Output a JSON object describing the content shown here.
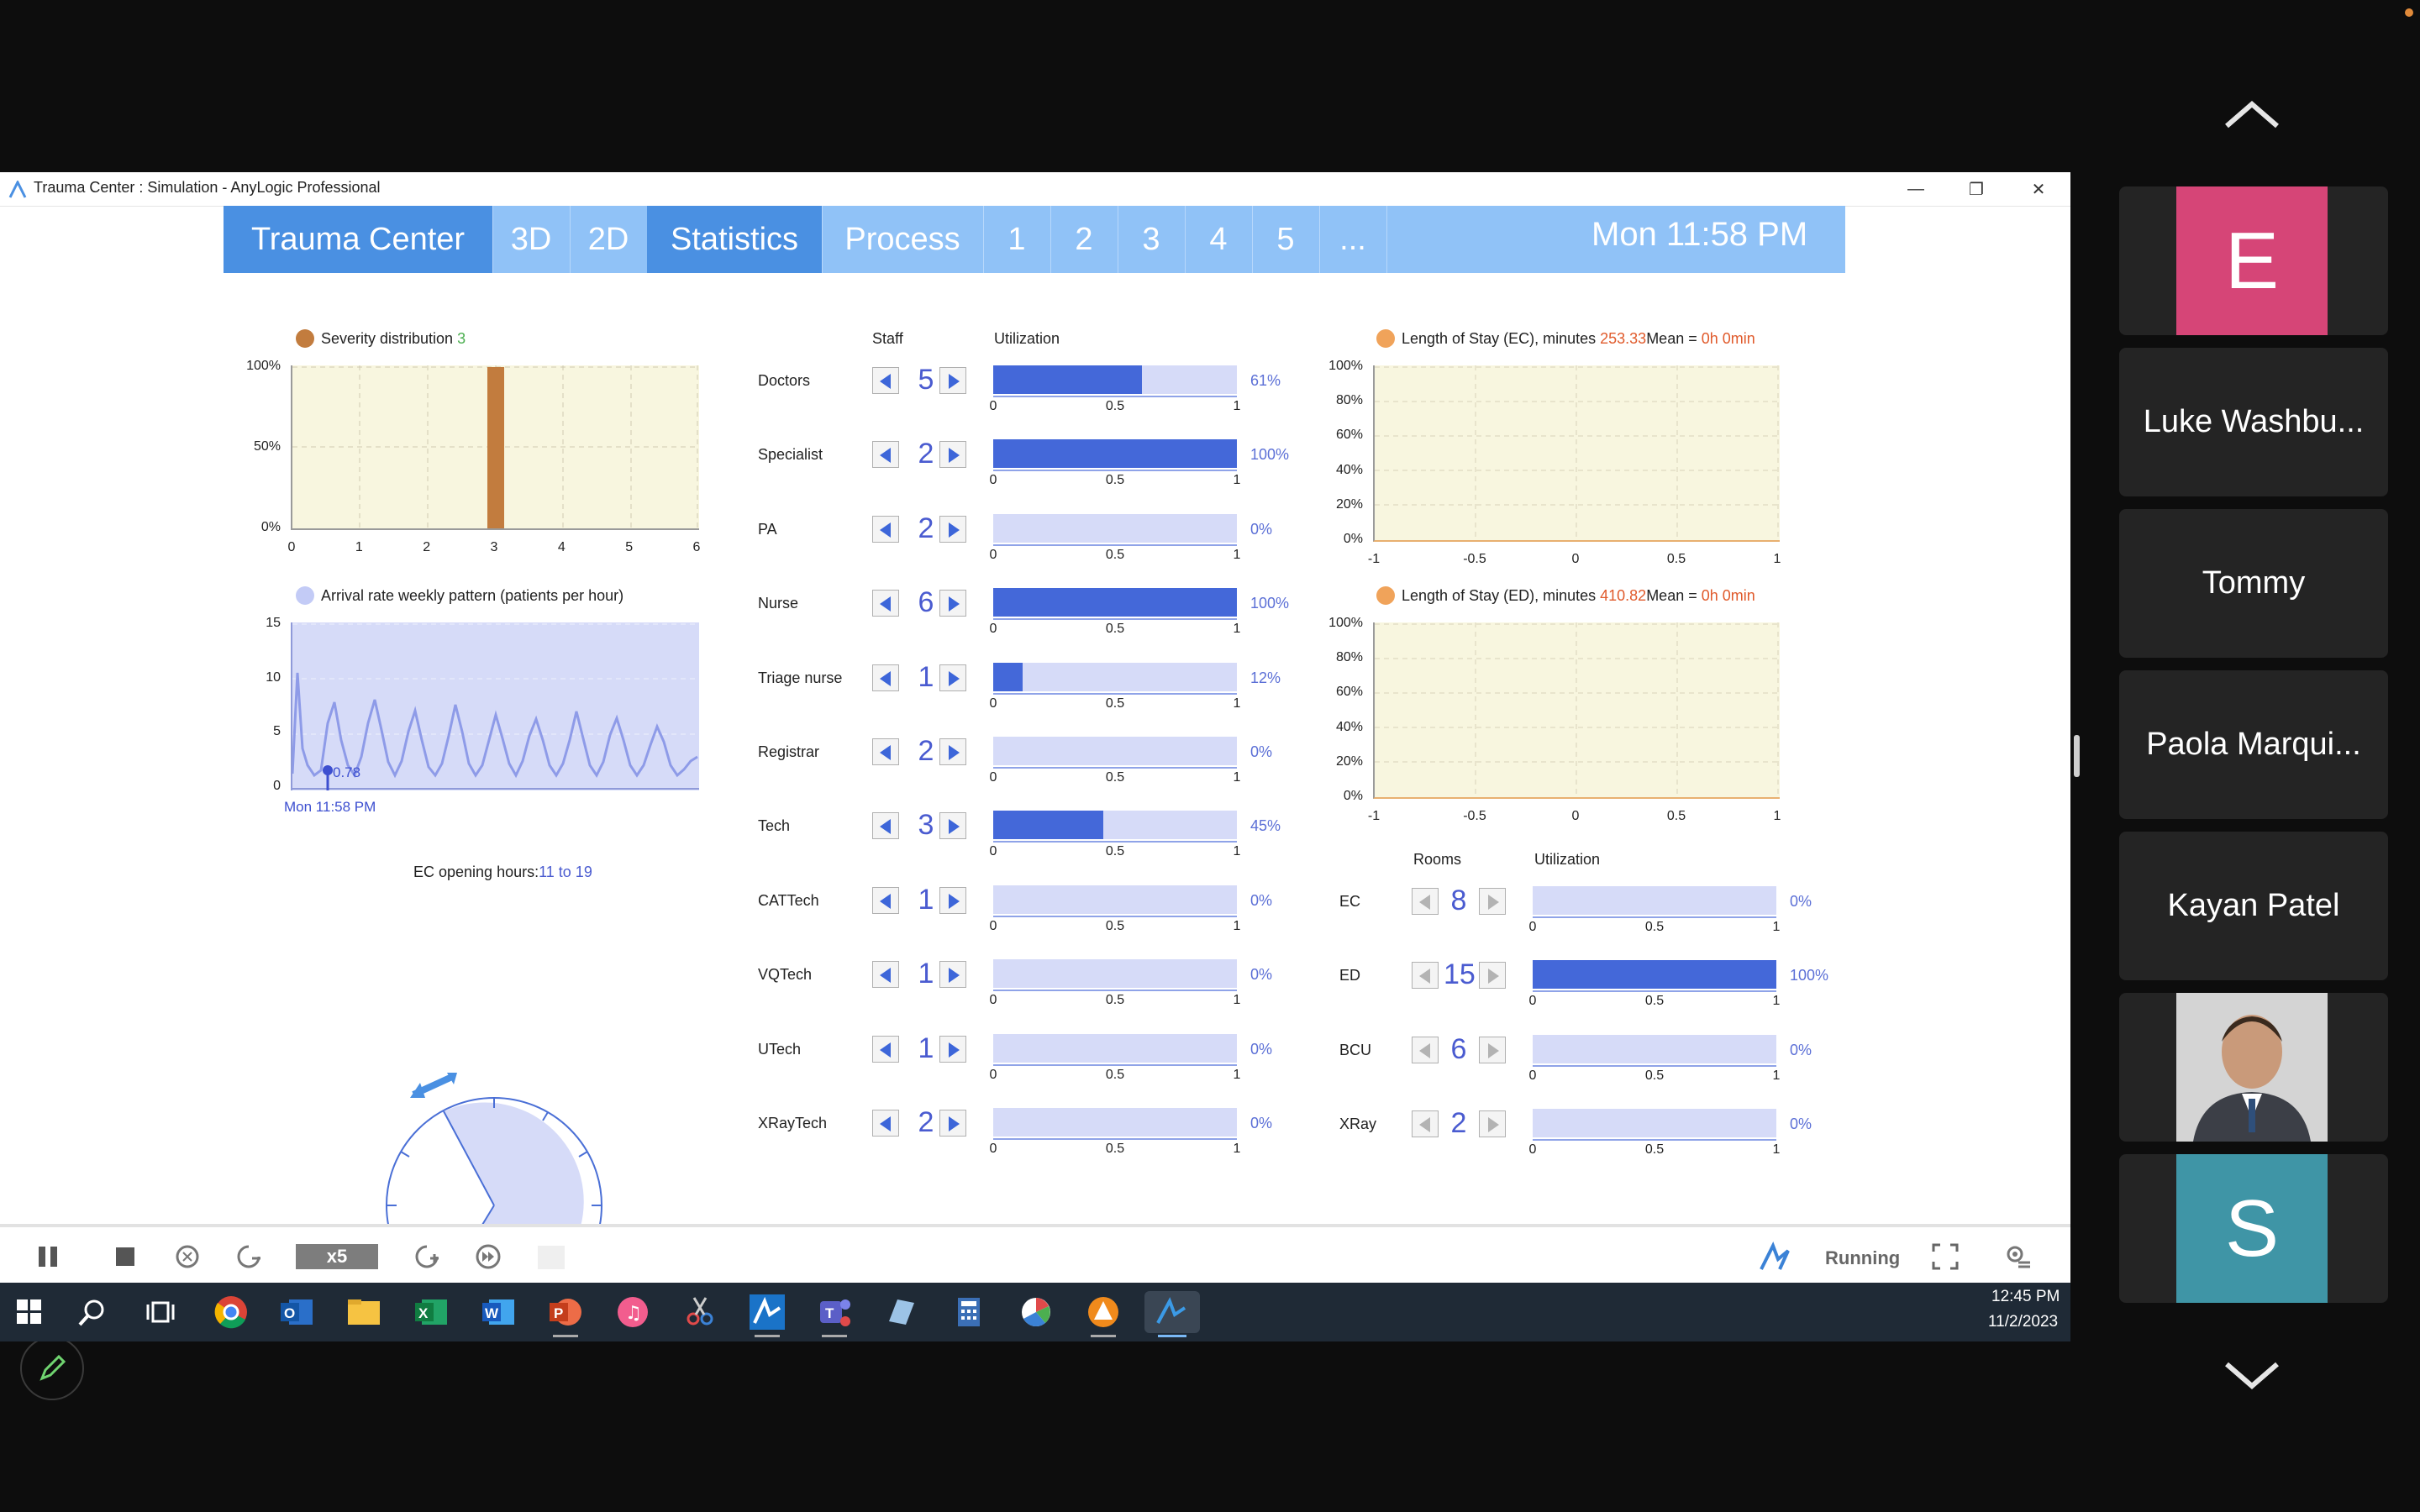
{
  "window": {
    "title": "Trauma Center : Simulation - AnyLogic Professional"
  },
  "nav": {
    "items": [
      "Trauma Center",
      "3D",
      "2D",
      "Statistics",
      "Process",
      "1",
      "2",
      "3",
      "4",
      "5",
      "..."
    ],
    "clock": "Mon 11:58 PM"
  },
  "severity": {
    "legend": "Severity distribution",
    "count": "3",
    "yticks": [
      "100%",
      "50%",
      "0%"
    ],
    "xticks": [
      "0",
      "1",
      "2",
      "3",
      "4",
      "5",
      "6"
    ]
  },
  "arrival": {
    "legend": "Arrival rate weekly pattern (patients per hour)",
    "yticks": [
      "15",
      "10",
      "5",
      "0"
    ],
    "marker_value": "0.78",
    "marker_label": "Mon 11:58 PM"
  },
  "clockdial": {
    "label": "EC opening hours:",
    "value": "11 to 19"
  },
  "staff": {
    "header_staff": "Staff",
    "header_util": "Utilization",
    "axis": [
      "0",
      "0.5",
      "1"
    ],
    "rows": [
      {
        "name": "Doctors",
        "count": "5",
        "pct": "61%"
      },
      {
        "name": "Specialist",
        "count": "2",
        "pct": "100%"
      },
      {
        "name": "PA",
        "count": "2",
        "pct": "0%"
      },
      {
        "name": "Nurse",
        "count": "6",
        "pct": "100%"
      },
      {
        "name": "Triage nurse",
        "count": "1",
        "pct": "12%"
      },
      {
        "name": "Registrar",
        "count": "2",
        "pct": "0%"
      },
      {
        "name": "Tech",
        "count": "3",
        "pct": "45%"
      },
      {
        "name": "CATTech",
        "count": "1",
        "pct": "0%"
      },
      {
        "name": "VQTech",
        "count": "1",
        "pct": "0%"
      },
      {
        "name": "UTech",
        "count": "1",
        "pct": "0%"
      },
      {
        "name": "XRayTech",
        "count": "2",
        "pct": "0%"
      }
    ]
  },
  "los_ec": {
    "label": "Length of Stay (EC), minutes",
    "value": "253.33",
    "mean_label": "Mean = ",
    "mean_value": "0h 0min",
    "yticks": [
      "100%",
      "80%",
      "60%",
      "40%",
      "20%",
      "0%"
    ],
    "xticks": [
      "-1",
      "-0.5",
      "0",
      "0.5",
      "1"
    ]
  },
  "los_ed": {
    "label": "Length of Stay (ED), minutes",
    "value": "410.82",
    "mean_label": "Mean = ",
    "mean_value": "0h 0min",
    "yticks": [
      "100%",
      "80%",
      "60%",
      "40%",
      "20%",
      "0%"
    ],
    "xticks": [
      "-1",
      "-0.5",
      "0",
      "0.5",
      "1"
    ]
  },
  "rooms": {
    "header_rooms": "Rooms",
    "header_util": "Utilization",
    "axis": [
      "0",
      "0.5",
      "1"
    ],
    "rows": [
      {
        "name": "EC",
        "count": "8",
        "pct": "0%"
      },
      {
        "name": "ED",
        "count": "15",
        "pct": "100%"
      },
      {
        "name": "BCU",
        "count": "6",
        "pct": "0%"
      },
      {
        "name": "XRay",
        "count": "2",
        "pct": "0%"
      }
    ]
  },
  "controls": {
    "speed": "x5",
    "status": "Running"
  },
  "taskbar": {
    "time": "12:45 PM",
    "date": "11/2/2023"
  },
  "participants": [
    {
      "name": "",
      "initial": "E",
      "color": "#d64577"
    },
    {
      "name": "Luke Washbu..."
    },
    {
      "name": "Tommy"
    },
    {
      "name": "Paola Marqui..."
    },
    {
      "name": "Kayan Patel"
    },
    {
      "name": "",
      "photo": true
    },
    {
      "name": "",
      "initial": "S",
      "color": "#3f95a6"
    }
  ]
}
